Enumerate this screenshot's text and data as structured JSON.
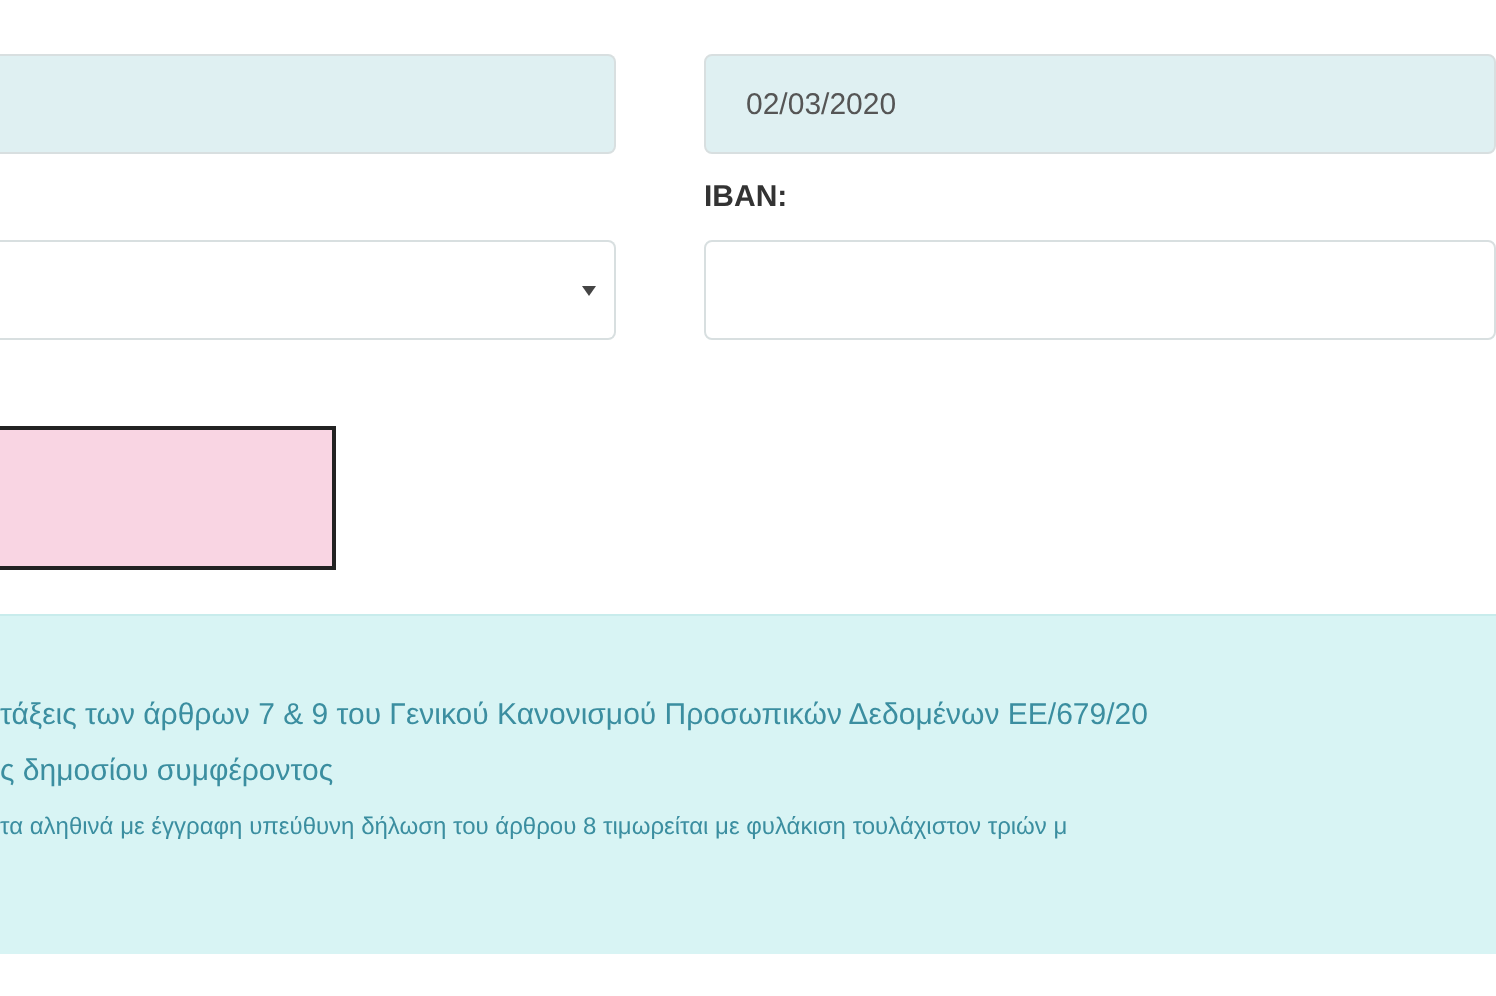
{
  "form": {
    "date_field": {
      "value": "02/03/2020"
    },
    "iban_label": "IBAN:"
  },
  "notice": {
    "lines": [
      "τάξεις των άρθρων 7 & 9 του Γενικού Κανονισμού Προσωπικών Δεδομένων ΕΕ/679/20",
      "ς δημοσίου συμφέροντος",
      "τα αληθινά με έγγραφη υπεύθυνη δήλωση του άρθρου 8 τιμωρείται με φυλάκιση τουλάχιστον τριών μ"
    ]
  }
}
